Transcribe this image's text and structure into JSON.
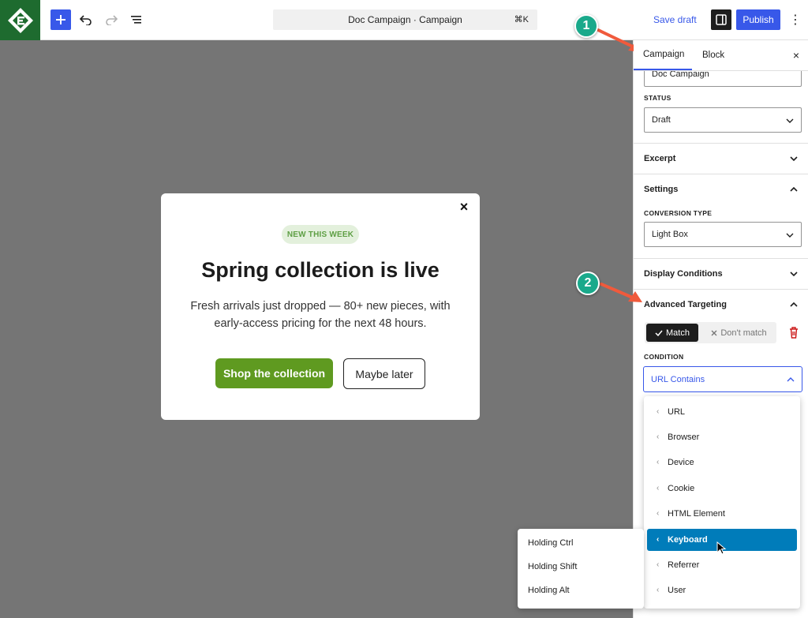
{
  "toolbar": {
    "doc_title": "Doc Campaign · Campaign",
    "shortcut": "⌘K",
    "save_draft_label": "Save draft",
    "publish_label": "Publish",
    "more_label": "⋮"
  },
  "modal": {
    "close_label": "×",
    "badge": "NEW THIS WEEK",
    "heading": "Spring collection is live",
    "body": "Fresh arrivals just dropped — 80+ new pieces, with early-access pricing for the next 48 hours.",
    "primary_cta": "Shop the collection",
    "secondary_cta": "Maybe later",
    "colors": {
      "primary": "#5f9a20",
      "badge_bg": "#e3f0dc"
    }
  },
  "sidebar": {
    "tabs": [
      {
        "label": "Campaign"
      },
      {
        "label": "Block"
      }
    ],
    "close_label": "×",
    "title_value": "Doc Campaign",
    "status_label": "STATUS",
    "status_value": "Draft",
    "panels": {
      "excerpt": "Excerpt",
      "settings": "Settings",
      "display_conditions": "Display Conditions",
      "advanced_targeting": "Advanced Targeting"
    },
    "conversion_type_label": "CONVERSION TYPE",
    "conversion_type_value": "Light Box",
    "match_label": "Match",
    "dont_match_label": "Don't match",
    "condition_label": "CONDITION",
    "condition_value": "URL Contains"
  },
  "condition_dropdown": {
    "items": [
      {
        "label": "URL"
      },
      {
        "label": "Browser"
      },
      {
        "label": "Device"
      },
      {
        "label": "Cookie"
      },
      {
        "label": "HTML Element"
      },
      {
        "label": "Keyboard"
      },
      {
        "label": "Referrer"
      },
      {
        "label": "User"
      }
    ],
    "active": "Keyboard"
  },
  "keyboard_submenu": {
    "items": [
      {
        "label": "Holding Ctrl"
      },
      {
        "label": "Holding Shift"
      },
      {
        "label": "Holding Alt"
      }
    ]
  },
  "annotations": {
    "markers": [
      {
        "label": "1"
      },
      {
        "label": "2"
      }
    ]
  },
  "accent_color": "#3858e9"
}
